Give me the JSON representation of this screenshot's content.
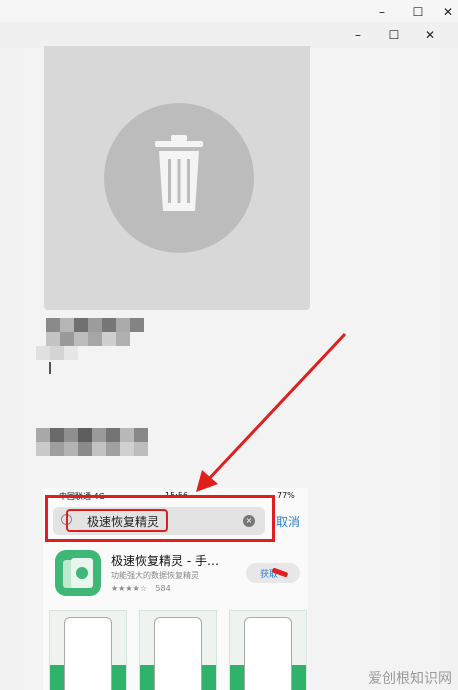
{
  "window": {
    "outer_controls": {
      "minimize": "–",
      "maximize": "☐",
      "close": "✕"
    },
    "inner_controls": {
      "minimize": "–",
      "maximize": "☐",
      "close": "✕"
    }
  },
  "status_bar": {
    "carrier": "中国联通 4G",
    "time": "15:56",
    "battery": "77%"
  },
  "search": {
    "query": "极速恢复精灵",
    "cancel_label": "取消"
  },
  "app": {
    "title": "极速恢复精灵 - 手…",
    "subtitle": "功能强大的数据恢复精灵",
    "rating_count": "584",
    "get_label": "获取"
  },
  "watermark": "爱创根知识网",
  "icons": [
    "trash-icon",
    "search-icon",
    "clear-icon",
    "app-icon"
  ],
  "colors": {
    "accent_blue": "#2a7fd4",
    "annotation_red": "#e01e1e",
    "app_green": "#3fb776"
  }
}
